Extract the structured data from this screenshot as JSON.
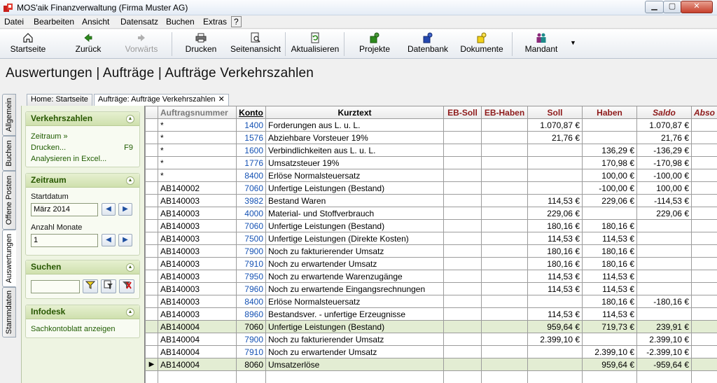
{
  "window": {
    "title": "MOS'aik Finanzverwaltung (Firma Muster AG)"
  },
  "menu": [
    "Datei",
    "Bearbeiten",
    "Ansicht",
    "Datensatz",
    "Buchen",
    "Extras",
    "?"
  ],
  "toolbar": {
    "buttons": [
      {
        "label": "Startseite",
        "icon": "home-icon"
      },
      {
        "label": "Zurück",
        "icon": "arrow-left-icon"
      },
      {
        "label": "Vorwärts",
        "icon": "arrow-right-icon",
        "disabled": true
      },
      {
        "label": "Drucken",
        "icon": "printer-icon"
      },
      {
        "label": "Seitenansicht",
        "icon": "print-preview-icon"
      },
      {
        "label": "Aktualisieren",
        "icon": "refresh-icon"
      },
      {
        "label": "Projekte",
        "icon": "projects-icon"
      },
      {
        "label": "Datenbank",
        "icon": "database-icon"
      },
      {
        "label": "Dokumente",
        "icon": "documents-icon"
      },
      {
        "label": "Mandant",
        "icon": "mandant-icon"
      }
    ]
  },
  "page_title": "Auswertungen | Aufträge | Aufträge Verkehrszahlen",
  "vertical_tabs": [
    "Allgemein",
    "Buchen",
    "Offene Posten",
    "Auswertungen",
    "Stammdaten"
  ],
  "doc_tabs": {
    "home": "Home: Startseite",
    "active": "Aufträge: Aufträge Verkehrszahlen",
    "close": "✕"
  },
  "panel": {
    "verkehrszahlen": {
      "title": "Verkehrszahlen",
      "links": [
        "Zeitraum »",
        "Drucken...",
        "Analysieren in Excel..."
      ],
      "print_shortcut": "F9"
    },
    "zeitraum": {
      "title": "Zeitraum",
      "start_label": "Startdatum",
      "start_value": "März 2014",
      "months_label": "Anzahl Monate",
      "months_value": "1"
    },
    "suchen": {
      "title": "Suchen",
      "search_value": ""
    },
    "infodesk": {
      "title": "Infodesk",
      "link": "Sachkontoblatt anzeigen"
    }
  },
  "grid": {
    "columns": [
      "Auftragsnummer",
      "Konto",
      "Kurztext",
      "EB-Soll",
      "EB-Haben",
      "Soll",
      "Haben",
      "Saldo",
      "Abso"
    ],
    "current_row_marker": "▶",
    "rows": [
      {
        "auftrag": "*",
        "konto": "1400",
        "kurztext": "Forderungen aus L. u. L.",
        "eb_soll": "",
        "eb_haben": "",
        "soll": "1.070,87 €",
        "haben": "",
        "saldo": "1.070,87 €"
      },
      {
        "auftrag": "*",
        "konto": "1576",
        "kurztext": "Abziehbare Vorsteuer 19%",
        "eb_soll": "",
        "eb_haben": "",
        "soll": "21,76 €",
        "haben": "",
        "saldo": "21,76 €"
      },
      {
        "auftrag": "*",
        "konto": "1600",
        "kurztext": "Verbindlichkeiten aus L. u. L.",
        "eb_soll": "",
        "eb_haben": "",
        "soll": "",
        "haben": "136,29 €",
        "saldo": "-136,29 €"
      },
      {
        "auftrag": "*",
        "konto": "1776",
        "kurztext": "Umsatzsteuer 19%",
        "eb_soll": "",
        "eb_haben": "",
        "soll": "",
        "haben": "170,98 €",
        "saldo": "-170,98 €"
      },
      {
        "auftrag": "*",
        "konto": "8400",
        "kurztext": "Erlöse Normalsteuersatz",
        "eb_soll": "",
        "eb_haben": "",
        "soll": "",
        "haben": "100,00 €",
        "saldo": "-100,00 €"
      },
      {
        "auftrag": "AB140002",
        "konto": "7060",
        "kurztext": "Unfertige Leistungen (Bestand)",
        "eb_soll": "",
        "eb_haben": "",
        "soll": "",
        "haben": "-100,00 €",
        "saldo": "100,00 €"
      },
      {
        "auftrag": "AB140003",
        "konto": "3982",
        "kurztext": "Bestand Waren",
        "eb_soll": "",
        "eb_haben": "",
        "soll": "114,53 €",
        "haben": "229,06 €",
        "saldo": "-114,53 €"
      },
      {
        "auftrag": "AB140003",
        "konto": "4000",
        "kurztext": "Material- und Stoffverbrauch",
        "eb_soll": "",
        "eb_haben": "",
        "soll": "229,06 €",
        "haben": "",
        "saldo": "229,06 €"
      },
      {
        "auftrag": "AB140003",
        "konto": "7060",
        "kurztext": "Unfertige Leistungen (Bestand)",
        "eb_soll": "",
        "eb_haben": "",
        "soll": "180,16 €",
        "haben": "180,16 €",
        "saldo": ""
      },
      {
        "auftrag": "AB140003",
        "konto": "7500",
        "kurztext": "Unfertige Leistungen (Direkte Kosten)",
        "eb_soll": "",
        "eb_haben": "",
        "soll": "114,53 €",
        "haben": "114,53 €",
        "saldo": ""
      },
      {
        "auftrag": "AB140003",
        "konto": "7900",
        "kurztext": "Noch zu fakturierender Umsatz",
        "eb_soll": "",
        "eb_haben": "",
        "soll": "180,16 €",
        "haben": "180,16 €",
        "saldo": ""
      },
      {
        "auftrag": "AB140003",
        "konto": "7910",
        "kurztext": "Noch zu erwartender Umsatz",
        "eb_soll": "",
        "eb_haben": "",
        "soll": "180,16 €",
        "haben": "180,16 €",
        "saldo": ""
      },
      {
        "auftrag": "AB140003",
        "konto": "7950",
        "kurztext": "Noch zu erwartende Warenzugänge",
        "eb_soll": "",
        "eb_haben": "",
        "soll": "114,53 €",
        "haben": "114,53 €",
        "saldo": ""
      },
      {
        "auftrag": "AB140003",
        "konto": "7960",
        "kurztext": "Noch zu erwartende Eingangsrechnungen",
        "eb_soll": "",
        "eb_haben": "",
        "soll": "114,53 €",
        "haben": "114,53 €",
        "saldo": ""
      },
      {
        "auftrag": "AB140003",
        "konto": "8400",
        "kurztext": "Erlöse Normalsteuersatz",
        "eb_soll": "",
        "eb_haben": "",
        "soll": "",
        "haben": "180,16 €",
        "saldo": "-180,16 €"
      },
      {
        "auftrag": "AB140003",
        "konto": "8960",
        "kurztext": "Bestandsver. - unfertige Erzeugnisse",
        "eb_soll": "",
        "eb_haben": "",
        "soll": "114,53 €",
        "haben": "114,53 €",
        "saldo": ""
      },
      {
        "auftrag": "AB140004",
        "konto": "7060",
        "kurztext": "Unfertige Leistungen (Bestand)",
        "eb_soll": "",
        "eb_haben": "",
        "soll": "959,64 €",
        "haben": "719,73 €",
        "saldo": "239,91 €",
        "highlight": true
      },
      {
        "auftrag": "AB140004",
        "konto": "7900",
        "kurztext": "Noch zu fakturierender Umsatz",
        "eb_soll": "",
        "eb_haben": "",
        "soll": "2.399,10 €",
        "haben": "",
        "saldo": "2.399,10 €"
      },
      {
        "auftrag": "AB140004",
        "konto": "7910",
        "kurztext": "Noch zu erwartender Umsatz",
        "eb_soll": "",
        "eb_haben": "",
        "soll": "",
        "haben": "2.399,10 €",
        "saldo": "-2.399,10 €"
      },
      {
        "auftrag": "AB140004",
        "konto": "8060",
        "kurztext": "Umsatzerlöse",
        "eb_soll": "",
        "eb_haben": "",
        "soll": "",
        "haben": "959,64 €",
        "saldo": "-959,64 €",
        "highlight": true,
        "current": true
      }
    ]
  }
}
